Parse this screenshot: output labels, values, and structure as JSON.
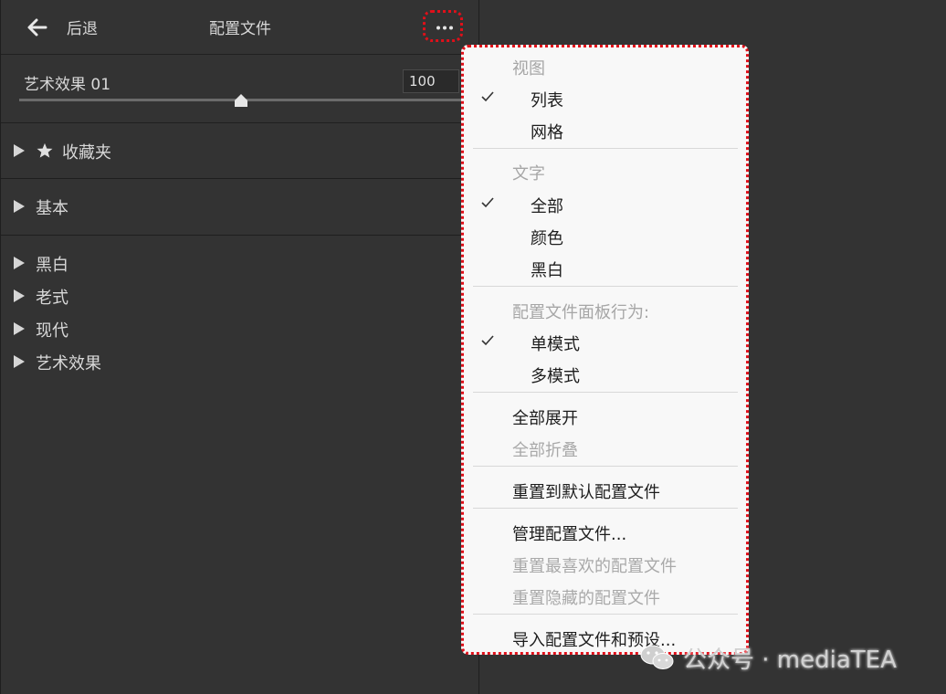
{
  "header": {
    "back_label": "后退",
    "title": "配置文件",
    "more_icon": "more-horizontal-icon"
  },
  "amount": {
    "label": "艺术效果 01",
    "value": "100",
    "slider_fraction": 0.5
  },
  "groups": {
    "favorites": "收藏夹",
    "basic": "基本",
    "bw": "黑白",
    "vintage": "老式",
    "modern": "现代",
    "artistic": "艺术效果"
  },
  "menu": {
    "view_header": "视图",
    "view_list": "列表",
    "view_grid": "网格",
    "text_header": "文字",
    "text_all": "全部",
    "text_color": "颜色",
    "text_bw": "黑白",
    "behavior_header": "配置文件面板行为:",
    "single_mode": "单模式",
    "multi_mode": "多模式",
    "expand_all": "全部展开",
    "collapse_all": "全部折叠",
    "reset_default": "重置到默认配置文件",
    "manage": "管理配置文件...",
    "reset_favorites": "重置最喜欢的配置文件",
    "reset_hidden": "重置隐藏的配置文件",
    "import": "导入配置文件和预设..."
  },
  "watermark": {
    "text": "公众号 · mediaTEA"
  },
  "colors": {
    "panel_bg": "#333333",
    "menu_bg": "#f8f8f8",
    "highlight": "#e0101a"
  }
}
